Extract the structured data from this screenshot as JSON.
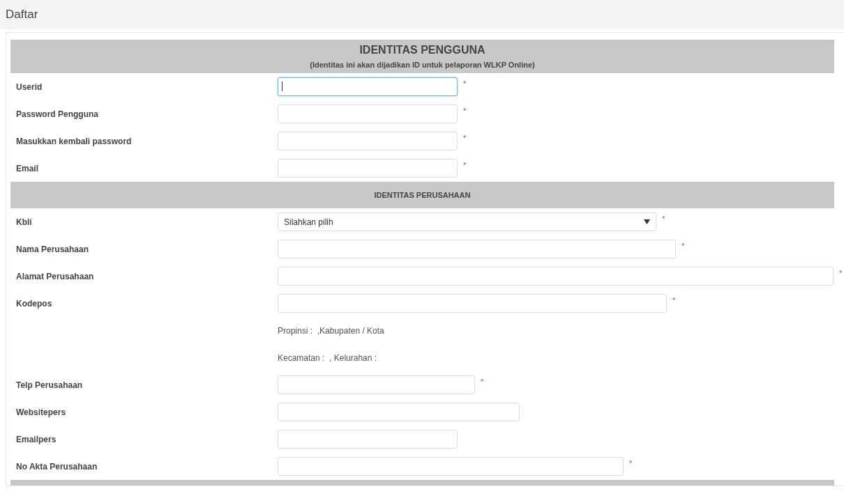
{
  "page_title": "Daftar",
  "sections": [
    {
      "title": "IDENTITAS PENGGUNA",
      "subtitle": "(Identitas ini akan dijadikan ID untuk pelaporan WLKP Online)",
      "rows": [
        {
          "kind": "input",
          "label": "Userid",
          "required_mark": "*",
          "focused": true
        },
        {
          "kind": "input",
          "label": "Password Pengguna",
          "required_mark": "*",
          "focused": false
        },
        {
          "kind": "input",
          "label": "Masukkan kembali password",
          "required_mark": "*",
          "focused": false
        },
        {
          "kind": "input",
          "label": "Email",
          "required_mark": "*",
          "focused": false
        }
      ]
    },
    {
      "title": "IDENTITAS PERUSAHAAN",
      "rows": [
        {
          "kind": "select",
          "label": "Kbli",
          "value": "Silahkan pilih",
          "required_mark": "*"
        },
        {
          "kind": "input",
          "label": "Nama Perusahaan",
          "required_mark": "*",
          "focused": false
        },
        {
          "kind": "input",
          "label": "Alamat Perusahaan",
          "required_mark": "*",
          "focused": false
        },
        {
          "kind": "input",
          "label": "Kodepos",
          "required_mark": "*",
          "focused": false
        },
        {
          "kind": "info",
          "text": "Propinsi :  ,Kabupaten / Kota"
        },
        {
          "kind": "info",
          "text": "Kecamatan :  , Kelurahan :"
        },
        {
          "kind": "input",
          "label": "Telp Perusahaan",
          "required_mark": "*",
          "focused": false
        },
        {
          "kind": "input",
          "label": "Websitepers",
          "focused": false
        },
        {
          "kind": "input",
          "label": "Emailpers",
          "focused": false
        },
        {
          "kind": "input",
          "label": "No Akta Perusahaan",
          "required_mark": "*",
          "focused": false
        }
      ]
    }
  ]
}
